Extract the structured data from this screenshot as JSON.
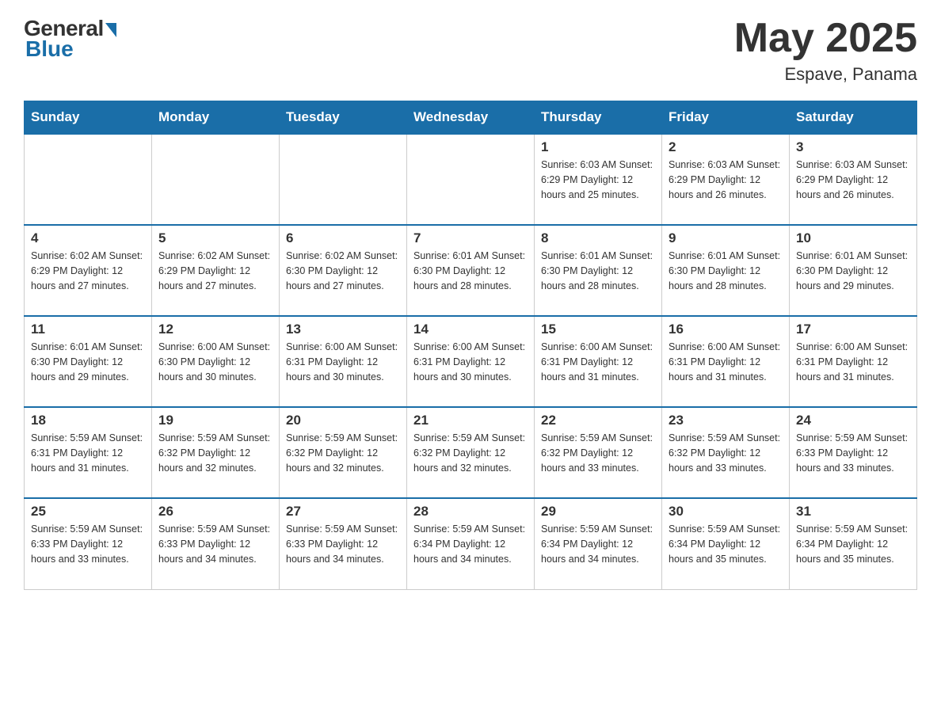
{
  "header": {
    "logo_general": "General",
    "logo_blue": "Blue",
    "month_title": "May 2025",
    "location": "Espave, Panama"
  },
  "days_of_week": [
    "Sunday",
    "Monday",
    "Tuesday",
    "Wednesday",
    "Thursday",
    "Friday",
    "Saturday"
  ],
  "weeks": [
    [
      {
        "day": "",
        "info": ""
      },
      {
        "day": "",
        "info": ""
      },
      {
        "day": "",
        "info": ""
      },
      {
        "day": "",
        "info": ""
      },
      {
        "day": "1",
        "info": "Sunrise: 6:03 AM\nSunset: 6:29 PM\nDaylight: 12 hours and 25 minutes."
      },
      {
        "day": "2",
        "info": "Sunrise: 6:03 AM\nSunset: 6:29 PM\nDaylight: 12 hours and 26 minutes."
      },
      {
        "day": "3",
        "info": "Sunrise: 6:03 AM\nSunset: 6:29 PM\nDaylight: 12 hours and 26 minutes."
      }
    ],
    [
      {
        "day": "4",
        "info": "Sunrise: 6:02 AM\nSunset: 6:29 PM\nDaylight: 12 hours and 27 minutes."
      },
      {
        "day": "5",
        "info": "Sunrise: 6:02 AM\nSunset: 6:29 PM\nDaylight: 12 hours and 27 minutes."
      },
      {
        "day": "6",
        "info": "Sunrise: 6:02 AM\nSunset: 6:30 PM\nDaylight: 12 hours and 27 minutes."
      },
      {
        "day": "7",
        "info": "Sunrise: 6:01 AM\nSunset: 6:30 PM\nDaylight: 12 hours and 28 minutes."
      },
      {
        "day": "8",
        "info": "Sunrise: 6:01 AM\nSunset: 6:30 PM\nDaylight: 12 hours and 28 minutes."
      },
      {
        "day": "9",
        "info": "Sunrise: 6:01 AM\nSunset: 6:30 PM\nDaylight: 12 hours and 28 minutes."
      },
      {
        "day": "10",
        "info": "Sunrise: 6:01 AM\nSunset: 6:30 PM\nDaylight: 12 hours and 29 minutes."
      }
    ],
    [
      {
        "day": "11",
        "info": "Sunrise: 6:01 AM\nSunset: 6:30 PM\nDaylight: 12 hours and 29 minutes."
      },
      {
        "day": "12",
        "info": "Sunrise: 6:00 AM\nSunset: 6:30 PM\nDaylight: 12 hours and 30 minutes."
      },
      {
        "day": "13",
        "info": "Sunrise: 6:00 AM\nSunset: 6:31 PM\nDaylight: 12 hours and 30 minutes."
      },
      {
        "day": "14",
        "info": "Sunrise: 6:00 AM\nSunset: 6:31 PM\nDaylight: 12 hours and 30 minutes."
      },
      {
        "day": "15",
        "info": "Sunrise: 6:00 AM\nSunset: 6:31 PM\nDaylight: 12 hours and 31 minutes."
      },
      {
        "day": "16",
        "info": "Sunrise: 6:00 AM\nSunset: 6:31 PM\nDaylight: 12 hours and 31 minutes."
      },
      {
        "day": "17",
        "info": "Sunrise: 6:00 AM\nSunset: 6:31 PM\nDaylight: 12 hours and 31 minutes."
      }
    ],
    [
      {
        "day": "18",
        "info": "Sunrise: 5:59 AM\nSunset: 6:31 PM\nDaylight: 12 hours and 31 minutes."
      },
      {
        "day": "19",
        "info": "Sunrise: 5:59 AM\nSunset: 6:32 PM\nDaylight: 12 hours and 32 minutes."
      },
      {
        "day": "20",
        "info": "Sunrise: 5:59 AM\nSunset: 6:32 PM\nDaylight: 12 hours and 32 minutes."
      },
      {
        "day": "21",
        "info": "Sunrise: 5:59 AM\nSunset: 6:32 PM\nDaylight: 12 hours and 32 minutes."
      },
      {
        "day": "22",
        "info": "Sunrise: 5:59 AM\nSunset: 6:32 PM\nDaylight: 12 hours and 33 minutes."
      },
      {
        "day": "23",
        "info": "Sunrise: 5:59 AM\nSunset: 6:32 PM\nDaylight: 12 hours and 33 minutes."
      },
      {
        "day": "24",
        "info": "Sunrise: 5:59 AM\nSunset: 6:33 PM\nDaylight: 12 hours and 33 minutes."
      }
    ],
    [
      {
        "day": "25",
        "info": "Sunrise: 5:59 AM\nSunset: 6:33 PM\nDaylight: 12 hours and 33 minutes."
      },
      {
        "day": "26",
        "info": "Sunrise: 5:59 AM\nSunset: 6:33 PM\nDaylight: 12 hours and 34 minutes."
      },
      {
        "day": "27",
        "info": "Sunrise: 5:59 AM\nSunset: 6:33 PM\nDaylight: 12 hours and 34 minutes."
      },
      {
        "day": "28",
        "info": "Sunrise: 5:59 AM\nSunset: 6:34 PM\nDaylight: 12 hours and 34 minutes."
      },
      {
        "day": "29",
        "info": "Sunrise: 5:59 AM\nSunset: 6:34 PM\nDaylight: 12 hours and 34 minutes."
      },
      {
        "day": "30",
        "info": "Sunrise: 5:59 AM\nSunset: 6:34 PM\nDaylight: 12 hours and 35 minutes."
      },
      {
        "day": "31",
        "info": "Sunrise: 5:59 AM\nSunset: 6:34 PM\nDaylight: 12 hours and 35 minutes."
      }
    ]
  ]
}
